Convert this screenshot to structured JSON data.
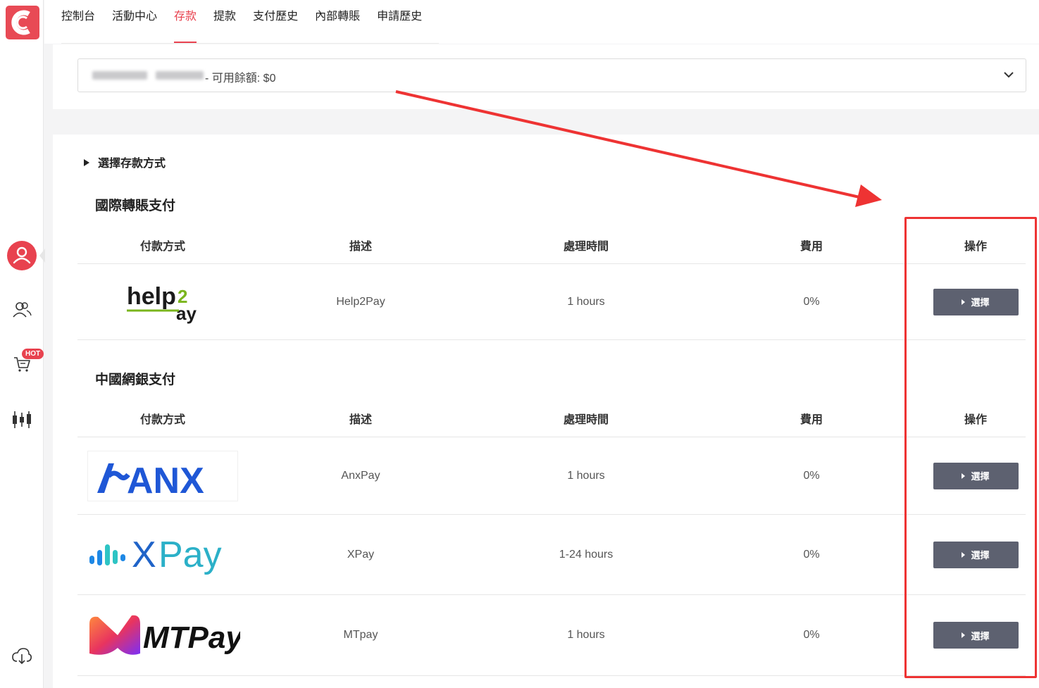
{
  "sidebar": {
    "logo_icon": "brand-c-logo",
    "icons": [
      "user-profile-icon",
      "users-icon",
      "cart-icon",
      "candlestick-chart-icon",
      "cloud-download-icon"
    ],
    "hot_badge": "HOT",
    "accent_color": "#e8424f"
  },
  "nav": {
    "tabs": [
      {
        "label": "控制台",
        "active": false
      },
      {
        "label": "活動中心",
        "active": false
      },
      {
        "label": "存款",
        "active": true
      },
      {
        "label": "提款",
        "active": false
      },
      {
        "label": "支付歷史",
        "active": false
      },
      {
        "label": "內部轉賬",
        "active": false
      },
      {
        "label": "申請歷史",
        "active": false
      }
    ]
  },
  "account": {
    "balance_text": "- 可用餘額: $0"
  },
  "deposit": {
    "section_title": "選擇存款方式",
    "columns": [
      "付款方式",
      "描述",
      "處理時間",
      "費用",
      "操作"
    ],
    "select_label": "選擇",
    "groups": [
      {
        "title": "國際轉賬支付",
        "methods": [
          {
            "logo_text": "help2pay",
            "description": "Help2Pay",
            "time": "1 hours",
            "fee": "0%"
          }
        ]
      },
      {
        "title": "中國網銀支付",
        "methods": [
          {
            "logo_text": "ANX",
            "description": "AnxPay",
            "time": "1 hours",
            "fee": "0%"
          },
          {
            "logo_text": "XPay",
            "description": "XPay",
            "time": "1-24 hours",
            "fee": "0%"
          },
          {
            "logo_text": "MTPay",
            "description": "MTpay",
            "time": "1 hours",
            "fee": "0%"
          }
        ]
      }
    ]
  },
  "annotation_color": "#ee3333"
}
